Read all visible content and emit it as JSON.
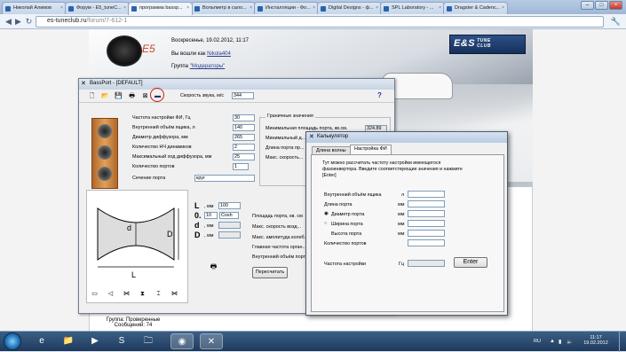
{
  "browser": {
    "tabs": [
      {
        "label": "Николай Алимов",
        "active": false
      },
      {
        "label": "Форум - E5_tuneC...",
        "active": false
      },
      {
        "label": "программа bassp...",
        "active": true
      },
      {
        "label": "Вольтметр в сало...",
        "active": false
      },
      {
        "label": "Инсталляции - Фо...",
        "active": false
      },
      {
        "label": "Digital Designs - ф...",
        "active": false
      },
      {
        "label": "SPL Laboratory - ...",
        "active": false
      },
      {
        "label": "Dragster & Cadenc...",
        "active": false
      }
    ],
    "url_host": "es-tuneclub.ru",
    "url_path": "/forum/7-612-1"
  },
  "site": {
    "date": "Воскресенье, 19.02.2012, 11:17",
    "login_prefix": "Вы вошли как",
    "login_user": "Nikola404",
    "group_prefix": "Группа",
    "group_name": "\"Модераторы\"",
    "logo_main": "E&S",
    "logo_sub1": "TUNE",
    "logo_sub2": "CLUB",
    "footer_group": "Группа: Проверенные",
    "footer_msgs": "Сообщений: 74"
  },
  "bassport": {
    "title": "BassPort - [DEFAULT]",
    "sound_speed_label": "Скорость звука, м/с",
    "sound_speed_value": "344",
    "help": "?",
    "params": [
      {
        "label": "Частота настройки ФИ, Гц",
        "value": "30"
      },
      {
        "label": "Внутренний объём ящика, л",
        "value": "140"
      },
      {
        "label": "Диаметр диффузора, мм",
        "value": "265"
      },
      {
        "label": "Количество НЧ динамиков",
        "value": "2"
      },
      {
        "label": "Максимальный ход диффузора, мм",
        "value": "25"
      },
      {
        "label": "Количество портов",
        "value": "1"
      }
    ],
    "port_section_label": "Сечение порта",
    "port_section_value": "круг",
    "group_title": "Граничные значения",
    "group_rows": [
      {
        "label": "Минимальная площадь порта, кв.см.",
        "value": "324.89"
      },
      {
        "label": "Минимальный д...",
        "value": ""
      },
      {
        "label": "Длина порта пр...",
        "value": ""
      },
      {
        "label": "Макс. скорость...",
        "value": ""
      }
    ],
    "dims": [
      {
        "letter": "L",
        "unit": ", мм",
        "value": "100"
      },
      {
        "letter": "0.",
        "unit": "",
        "value": "10",
        "extra": "Cosh"
      },
      {
        "letter": "d",
        "unit": ", мм",
        "value": ""
      },
      {
        "letter": "D",
        "unit": ", мм",
        "value": ""
      }
    ],
    "results": [
      "Площадь порта, кв. см",
      "Макс. скорость возд...",
      "Макс. амплитуда колеб...",
      "Главная частота орган...",
      "Внутренний объём порт..."
    ],
    "recalc_button": "Пересчитать",
    "diagram_labels": {
      "d": "d",
      "D": "D",
      "L": "L"
    }
  },
  "calc": {
    "title": "Калькулятор",
    "tabs": [
      "Длина волны",
      "Настройка ФИ"
    ],
    "active_tab": 1,
    "description": "Тут можно рассчитать частоту настройки имеющегося фазоинвертора. Введите соответствующие значения и нажмите [Enter]",
    "fields": [
      {
        "label": "Внутренний объём ящика",
        "unit": "л"
      },
      {
        "label": "Длина порта",
        "unit": "мм"
      },
      {
        "label": "Диаметр порта",
        "unit": "мм",
        "radio": true,
        "checked": true
      },
      {
        "label": "Ширина порта",
        "unit": "мм",
        "radio": true,
        "checked": false
      },
      {
        "label": "Высота порта",
        "unit": "мм"
      },
      {
        "label": "Количество портов",
        "unit": ""
      }
    ],
    "freq_label": "Частота настройки",
    "freq_unit": "Гц",
    "enter_button": "Enter"
  },
  "taskbar": {
    "lang": "RU",
    "time": "11:17",
    "date": "19.02.2012"
  },
  "colors": {
    "accent": "#2b3f8c",
    "highlight": "#d11111"
  }
}
